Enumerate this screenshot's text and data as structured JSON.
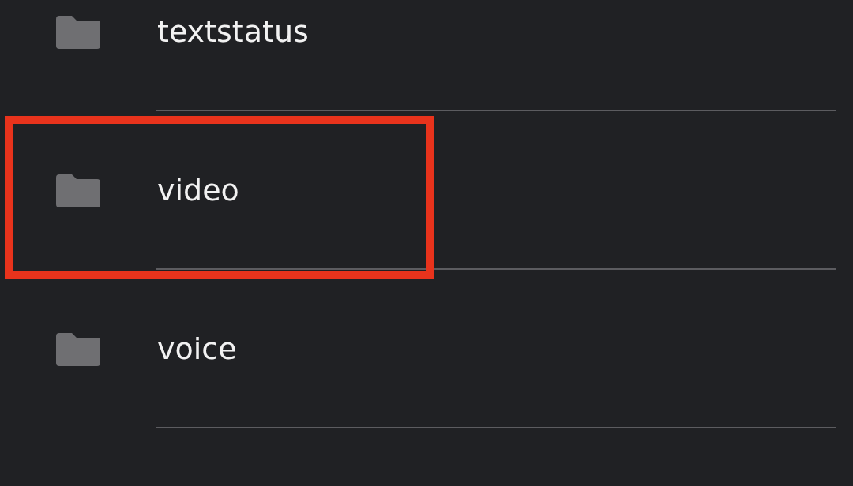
{
  "folders": [
    {
      "name": "textstatus",
      "highlighted": false
    },
    {
      "name": "video",
      "highlighted": true
    },
    {
      "name": "voice",
      "highlighted": false
    }
  ]
}
